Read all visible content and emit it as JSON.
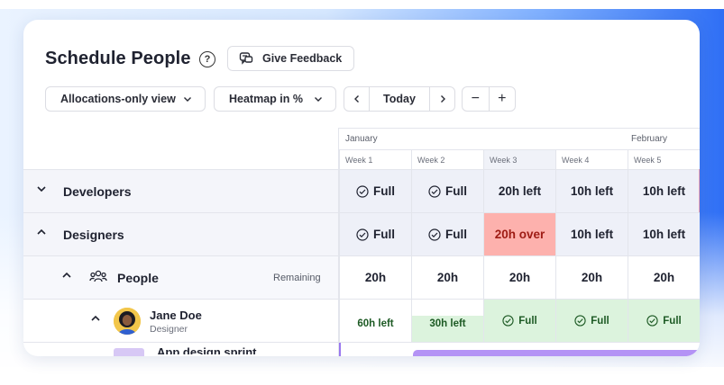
{
  "header": {
    "title": "Schedule People",
    "feedback_label": "Give Feedback"
  },
  "toolbar": {
    "view_select": "Allocations-only view",
    "heatmap_select": "Heatmap in %",
    "today_label": "Today",
    "zoom_out": "−",
    "zoom_in": "+"
  },
  "timeline": {
    "months": [
      "January",
      "February"
    ],
    "weeks": [
      "Week 1",
      "Week 2",
      "Week 3",
      "Week 4",
      "Week 5"
    ]
  },
  "rows": {
    "developers": {
      "label": "Developers",
      "cells": [
        "Full",
        "Full",
        "20h left",
        "10h left",
        "10h left"
      ]
    },
    "designers": {
      "label": "Designers",
      "cells": [
        "Full",
        "Full",
        "20h over",
        "10h left",
        "10h left"
      ]
    },
    "people": {
      "label": "People",
      "remaining_label": "Remaining",
      "cells": [
        "20h",
        "20h",
        "20h",
        "20h",
        "20h"
      ]
    },
    "person": {
      "name": "Jane Doe",
      "role": "Designer",
      "cells": [
        "60h left",
        "30h left",
        "Full",
        "Full",
        "Full"
      ]
    },
    "task": {
      "label": "App design sprint"
    }
  },
  "colors": {
    "over_bg": "#fdb1ad",
    "over_text": "#9e1b14",
    "full_green_bg": "#dcf3dd",
    "task_purple": "#b493f5"
  }
}
